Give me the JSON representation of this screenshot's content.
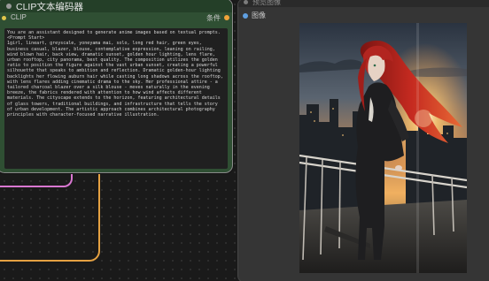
{
  "clip_node": {
    "title": "CLIP文本编码器",
    "input_label": "CLIP",
    "output_label": "条件",
    "prompt_text": "You are an assistant designed to generate anime images based on textual prompts.\n<Prompt Start>\n1girl, lineart, greyscale, yoneyama mai, solo, long red hair, green eyes, business casual, blazer, blouse, contemplative expression, leaning on railing, wind blown hair, back view, dramatic sunset, golden hour lighting, lens flare, urban rooftop, city panorama, best quality. The composition utilizes the golden ratio to position the figure against the vast urban sunset, creating a powerful silhouette that speaks to ambition and reflection. Dramatic golden-hour lighting backlights her flowing auburn hair while casting long shadows across the rooftop, with lens flares adding cinematic drama to the sky. Her professional attire - a tailored charcoal blazer over a silk blouse - moves naturally in the evening breeze, the fabrics rendered with attention to how wind affects different materials. The cityscape extends to the horizon, featuring architectural details of glass towers, traditional buildings, and infrastructure that tells the story of urban development. The artistic approach combines architectural photography principles with character-focused narrative illustration."
  },
  "preview_node": {
    "title": "预览图像",
    "input_label": "图像",
    "image_description_icon": "anime-girl-rooftop-sunset-image"
  },
  "colors": {
    "clip_node_body": "#2f4f33",
    "clip_input_port": "#e0c64b",
    "conditioning_output_port": "#f0a33a",
    "image_input_port": "#5f9fe0",
    "wire_pink": "#d977d1",
    "wire_orange": "#e5a142",
    "canvas_background": "#1a1a1a"
  }
}
